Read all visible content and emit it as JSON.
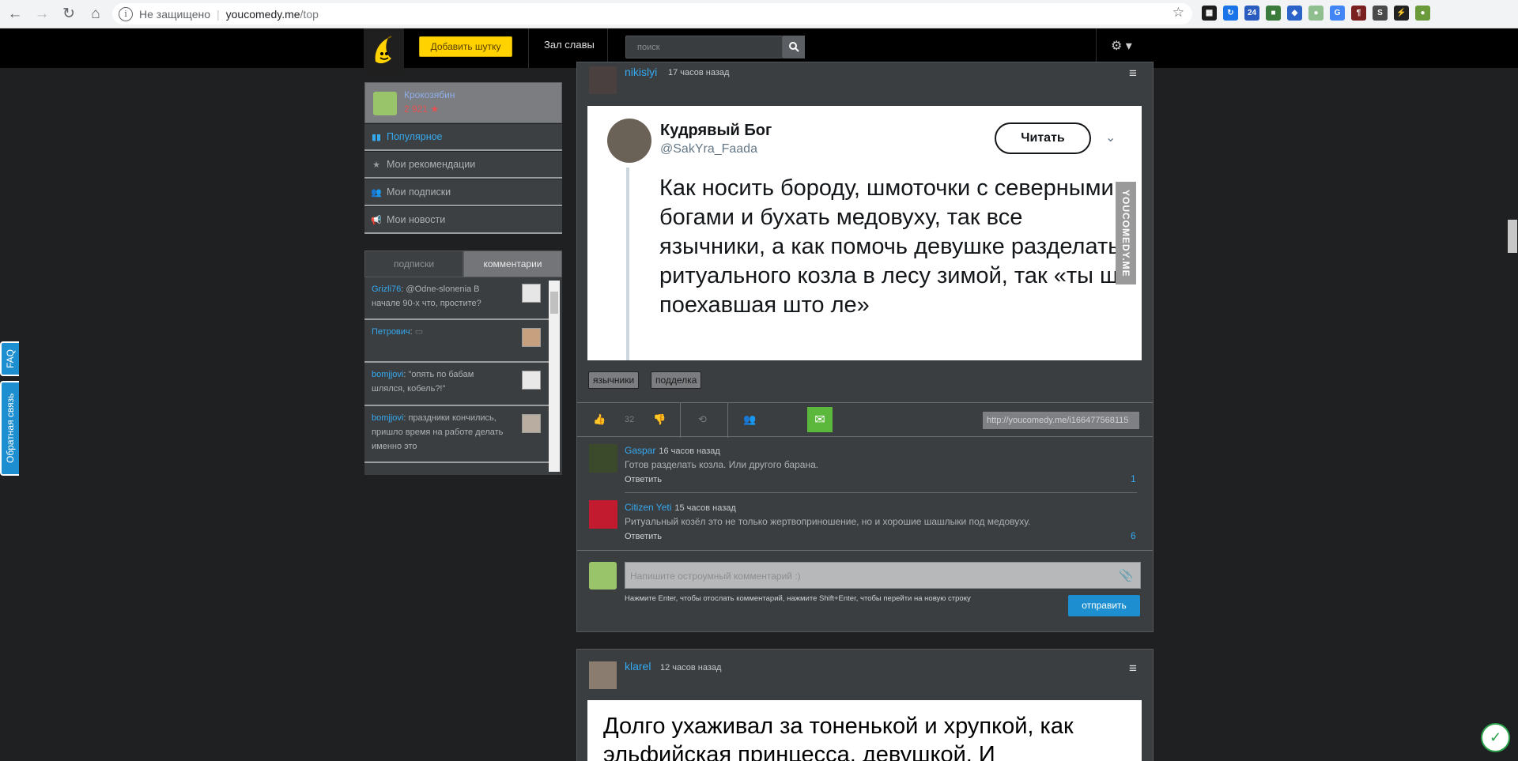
{
  "browser": {
    "security_label": "Не защищено",
    "url_host": "youcomedy.me",
    "url_path": "/top",
    "info_icon": "i",
    "extensions": [
      {
        "name": "trello-ext-icon",
        "color": "#1d1d1d",
        "glyph": "▦"
      },
      {
        "name": "translate-ext-icon",
        "color": "#1a73e8",
        "glyph": "↻"
      },
      {
        "name": "counter-ext-icon",
        "color": "#2a5cbf",
        "glyph": "24"
      },
      {
        "name": "ext-green-icon",
        "color": "#3a7a3a",
        "glyph": "■"
      },
      {
        "name": "shield-ext-icon",
        "color": "#2b63c8",
        "glyph": "◆"
      },
      {
        "name": "circle-ext-icon",
        "color": "#8fbf8f",
        "glyph": "●"
      },
      {
        "name": "google-translate-ext-icon",
        "color": "#4285f4",
        "glyph": "G"
      },
      {
        "name": "ext-red-icon",
        "color": "#7a2020",
        "glyph": "¶"
      },
      {
        "name": "ext-s-icon",
        "color": "#4a4a4a",
        "glyph": "S"
      },
      {
        "name": "lightning-ext-icon",
        "color": "#222222",
        "glyph": "⚡"
      },
      {
        "name": "profile-avatar-icon",
        "color": "#6a9a3a",
        "glyph": "●"
      }
    ]
  },
  "header": {
    "add_joke_label": "Добавить шутку",
    "hall_of_fame_label": "Зал славы",
    "search_placeholder": "поиск",
    "accent": "#ffd200"
  },
  "side_tabs": {
    "faq_label": "FAQ",
    "feedback_label": "Обратная связь"
  },
  "profile": {
    "username": "Крокозябин",
    "score": "2 921 ★"
  },
  "nav": [
    {
      "label": "Популярное",
      "icon": "bar-chart-icon",
      "active": true
    },
    {
      "label": "Мои рекомендации",
      "icon": "star-icon",
      "active": false
    },
    {
      "label": "Мои подписки",
      "icon": "users-icon",
      "active": false
    },
    {
      "label": "Мои новости",
      "icon": "megaphone-icon",
      "active": false
    }
  ],
  "feed_tabs": {
    "subscriptions_label": "подписки",
    "comments_label": "комментарии"
  },
  "feed": [
    {
      "user": "Grizli76",
      "text": ": @Odne-slonenia В начале 90-х что, простите?"
    },
    {
      "user": "Петрович",
      "text": ":"
    },
    {
      "user": "bomjjovi",
      "text": ": \"опять по бабам шлялся, кобель?!\""
    },
    {
      "user": "bomjjovi",
      "text": ": праздники кончились, пришло время на работе делать именно это"
    }
  ],
  "post1": {
    "author": "nikislyi",
    "time": "17 часов назад",
    "tweet": {
      "name": "Кудрявый Бог",
      "handle": "@SakYra_Faada",
      "read_button": "Читать",
      "text": "Как носить бороду, шмоточки с северными богами и бухать медовуху, так все язычники, а как помочь девушке разделать ритуального козла в лесу зимой, так «ты шо поехавшая што ле»",
      "watermark": "YOUCOMEDY.ME"
    },
    "tags": [
      "язычники",
      "подделка"
    ],
    "likes": "32",
    "permalink": "http://youcomedy.me/i166477568115",
    "comments": [
      {
        "author": "Gaspar",
        "time": "16 часов назад",
        "text": "Готов разделать козла. Или другого барана.",
        "reply": "Ответить",
        "count": "1"
      },
      {
        "author": "Citizen Yeti",
        "time": "15 часов назад",
        "text": "Ритуальный козёл это не только жертвоприношение, но и хорошие шашлыки под медовуху.",
        "reply": "Ответить",
        "count": "6"
      }
    ],
    "comment_placeholder": "Напишите остроумный комментарий :)",
    "hint": "Нажмите Enter, чтобы отослать комментарий, нажмите Shift+Enter, чтобы перейти на новую строку",
    "send_label": "отправить"
  },
  "post2": {
    "author": "klarel",
    "time": "12 часов назад",
    "image_text": "Долго ухаживал за тоненькой и хрупкой, как эльфийская принцесса, девушкой. И"
  }
}
